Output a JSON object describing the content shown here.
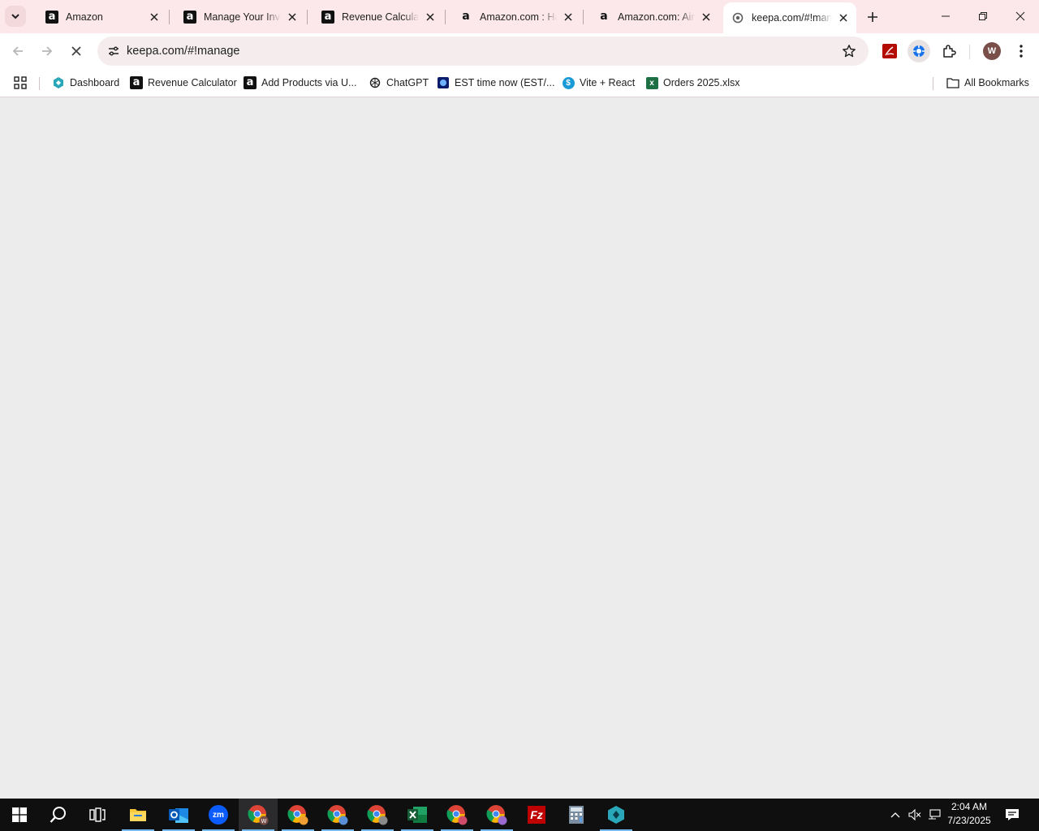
{
  "tabs": [
    {
      "title": "Amazon",
      "favicon": "amazon-icon",
      "active": false
    },
    {
      "title": "Manage Your Inventory",
      "favicon": "amazon-icon",
      "active": false
    },
    {
      "title": "Revenue Calculator",
      "favicon": "amazon-icon",
      "active": false
    },
    {
      "title": "Amazon.com : Hand",
      "favicon": "amazon-smile-icon",
      "active": false
    },
    {
      "title": "Amazon.com: Airtag",
      "favicon": "amazon-smile-icon",
      "active": false
    },
    {
      "title": "keepa.com/#!manage",
      "favicon": "loading-icon",
      "active": true
    }
  ],
  "omnibox": {
    "url": "keepa.com/#!manage"
  },
  "bookmarks": [
    {
      "label": "Dashboard",
      "icon": "dashboard-icon"
    },
    {
      "label": "Revenue Calculator",
      "icon": "amazon-icon"
    },
    {
      "label": "Add Products via U...",
      "icon": "amazon-icon"
    },
    {
      "label": "ChatGPT",
      "icon": "chatgpt-icon"
    },
    {
      "label": "EST time now (EST/...",
      "icon": "globe-icon"
    },
    {
      "label": "Vite + React",
      "icon": "dollar-icon"
    },
    {
      "label": "Orders 2025.xlsx",
      "icon": "excel-icon"
    }
  ],
  "all_bookmarks": "All Bookmarks",
  "profile_initial": "W",
  "clock": {
    "time": "2:04 AM",
    "date": "7/23/2025"
  },
  "colors": {
    "tabstrip": "#fce8ea",
    "content": "#ececec",
    "taskbar": "#0f0f10",
    "accent": "#0b57d0"
  }
}
